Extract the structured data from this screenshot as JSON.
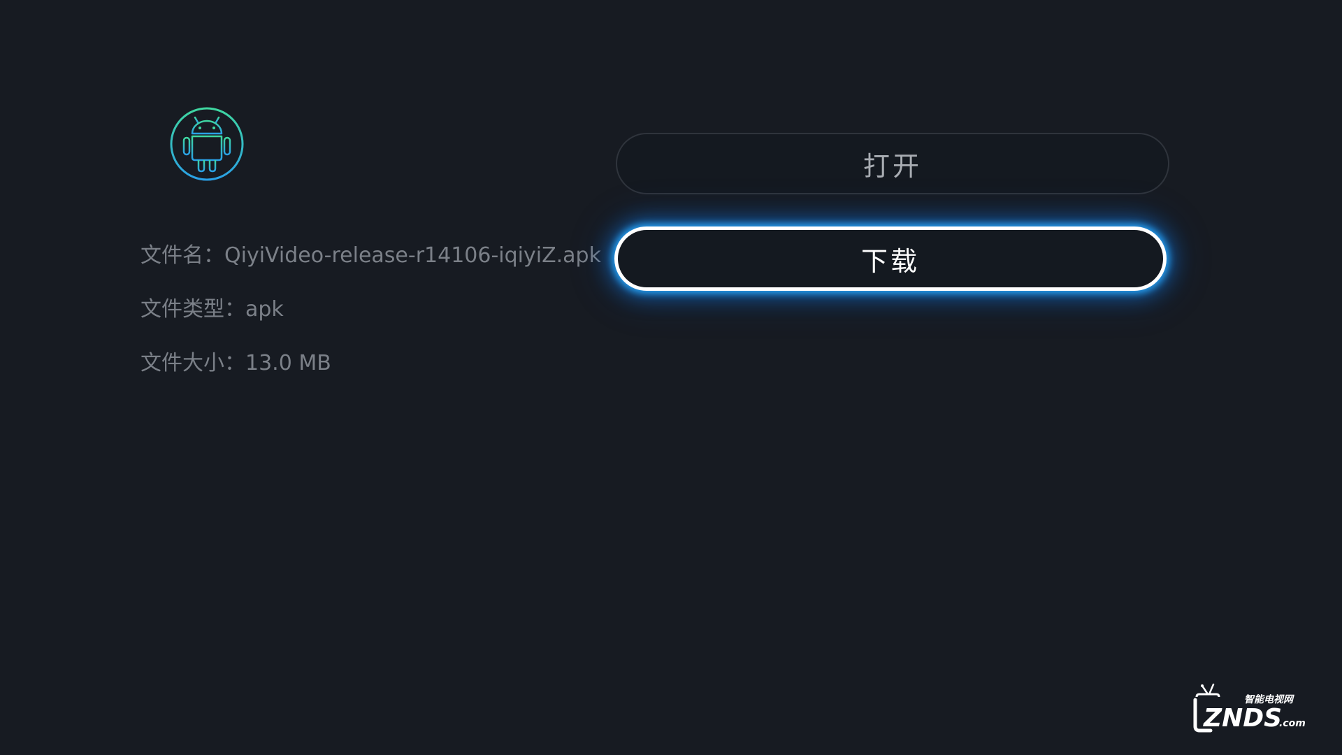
{
  "app_icon": "android-icon",
  "file_info": {
    "name_label": "文件名：QiyiVideo-release-r14106-iqiyiZ.apk",
    "type_label": "文件类型：apk",
    "size_label": "文件大小：13.0 MB"
  },
  "buttons": {
    "open_label": "打开",
    "download_label": "下载"
  },
  "watermark": {
    "icon": "znds-tv-logo",
    "text_top": "智能电视网",
    "text_main": "ZNDS",
    "text_suffix": ".com"
  },
  "colors": {
    "background": "#171b22",
    "focus_glow": "#28aaff",
    "icon_gradient_start": "#3fd7a0",
    "icon_gradient_end": "#2aa0e6"
  }
}
